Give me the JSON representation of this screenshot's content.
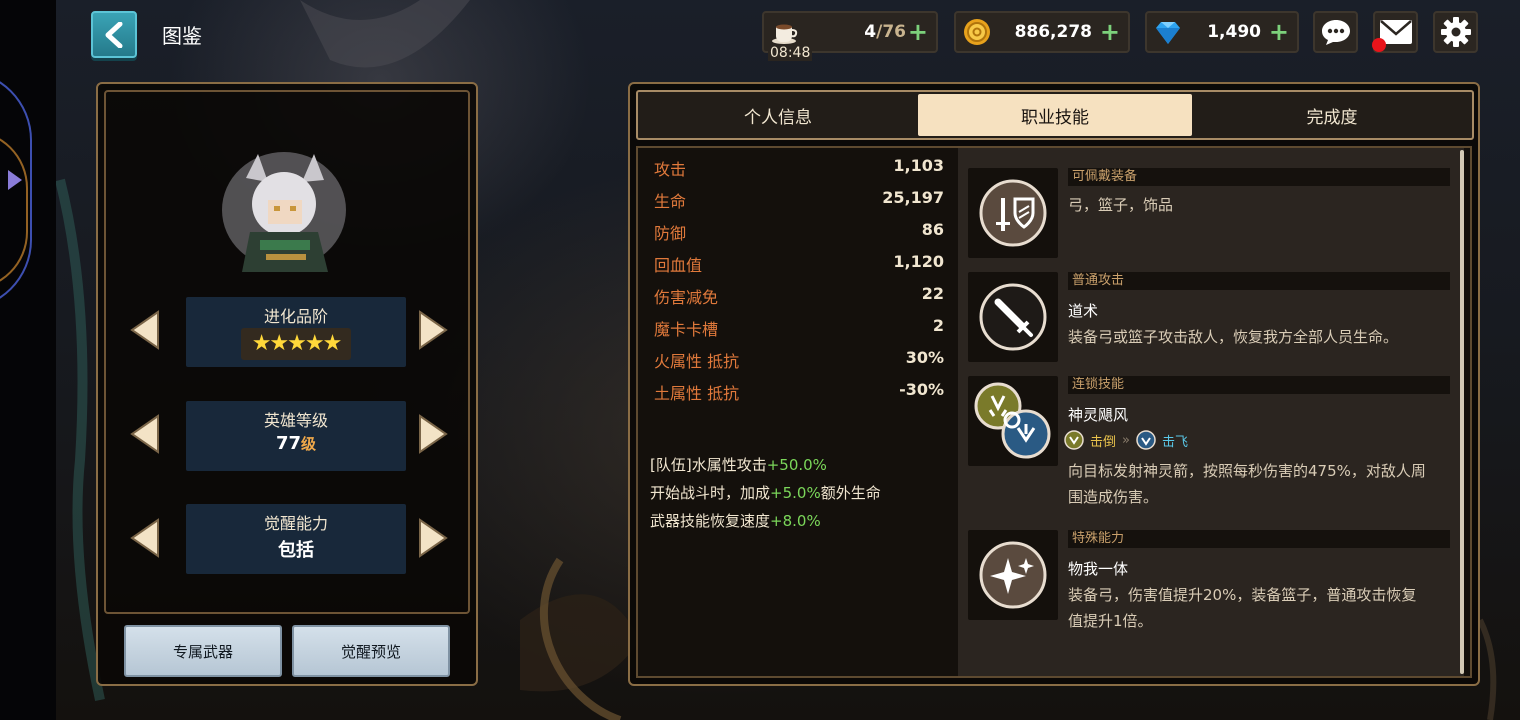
{
  "header": {
    "title": "图鉴"
  },
  "resources": {
    "stamina": {
      "value": "4",
      "max": "/76",
      "timer": "08:48",
      "icon": "coffee-cup-icon"
    },
    "gold": {
      "value": "886,278",
      "icon": "gold-coin-icon"
    },
    "gems": {
      "value": "1,490",
      "icon": "diamond-icon"
    }
  },
  "left": {
    "evolution": {
      "label": "进化品阶",
      "stars": "★★★★★"
    },
    "level": {
      "label": "英雄等级",
      "value": "77",
      "unit": "级"
    },
    "awaken": {
      "label": "觉醒能力",
      "value": "包括"
    },
    "buttons": {
      "weapon": "专属武器",
      "awaken_preview": "觉醒预览"
    }
  },
  "tabs": [
    "个人信息",
    "职业技能",
    "完成度"
  ],
  "stats": [
    {
      "k": "攻击",
      "v": "1,103"
    },
    {
      "k": "生命",
      "v": "25,197"
    },
    {
      "k": "防御",
      "v": "86"
    },
    {
      "k": "回血值",
      "v": "1,120"
    },
    {
      "k": "伤害减免",
      "v": "22"
    },
    {
      "k": "魔卡卡槽",
      "v": "2"
    },
    {
      "k": "火属性 抵抗",
      "v": "30%"
    },
    {
      "k": "土属性 抵抗",
      "v": "-30%"
    }
  ],
  "bonuses": [
    {
      "pre": "[队伍]水属性攻击",
      "green": "+50.0%",
      "post": ""
    },
    {
      "pre": "开始战斗时，加成",
      "green": "+5.0%",
      "post": "额外生命"
    },
    {
      "pre": "武器技能恢复速度",
      "green": "+8.0%",
      "post": ""
    }
  ],
  "skills": {
    "equip": {
      "head": "可佩戴装备",
      "desc": "弓，篮子，饰品"
    },
    "normal": {
      "head": "普通攻击",
      "name": "道术",
      "desc": "装备弓或篮子攻击敌人，恢复我方全部人员生命。"
    },
    "chain": {
      "head": "连锁技能",
      "name": "神灵飓风",
      "from": "击倒",
      "sep": "»",
      "to": "击飞",
      "desc": "向目标发射神灵箭，按照每秒伤害的475%，对敌人周围造成伤害。"
    },
    "special": {
      "head": "特殊能力",
      "name": "物我一体",
      "desc": "装备弓，伤害值提升20%，装备篮子，普通攻击恢复值提升1倍。"
    }
  }
}
